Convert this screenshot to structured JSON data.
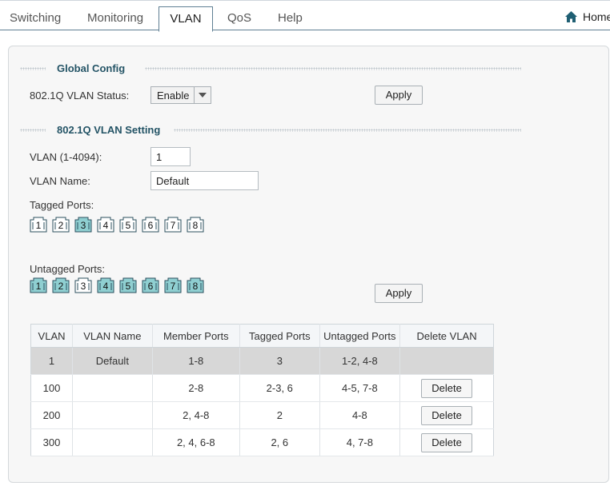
{
  "nav": {
    "tabs": [
      "Switching",
      "Monitoring",
      "VLAN",
      "QoS",
      "Help"
    ],
    "active_tab": "VLAN",
    "home_label": "Home",
    "home_icon": "house-icon"
  },
  "global_config": {
    "title": "Global Config",
    "status_label": "802.1Q VLAN Status:",
    "status_value": "Enable",
    "apply_label": "Apply"
  },
  "vlan_setting": {
    "title": "802.1Q VLAN Setting",
    "vlan_id_label": "VLAN (1-4094):",
    "vlan_id_value": "1",
    "vlan_name_label": "VLAN Name:",
    "vlan_name_value": "Default",
    "tagged_label": "Tagged Ports:",
    "untagged_label": "Untagged Ports:",
    "apply_label": "Apply",
    "ports": [
      "1",
      "2",
      "3",
      "4",
      "5",
      "6",
      "7",
      "8"
    ],
    "tagged_selected": [
      false,
      false,
      true,
      false,
      false,
      false,
      false,
      false
    ],
    "untagged_selected": [
      true,
      true,
      false,
      true,
      true,
      true,
      true,
      true
    ],
    "selected_color": "#8fcfd1",
    "unselected_color": "#ffffff"
  },
  "table": {
    "headers": [
      "VLAN",
      "VLAN Name",
      "Member Ports",
      "Tagged Ports",
      "Untagged Ports",
      "Delete VLAN"
    ],
    "rows": [
      {
        "vlan": "1",
        "name": "Default",
        "members": "1-8",
        "tagged": "3",
        "untagged": "1-2, 4-8",
        "delete": ""
      },
      {
        "vlan": "100",
        "name": "",
        "members": "2-8",
        "tagged": "2-3, 6",
        "untagged": "4-5, 7-8",
        "delete": "Delete"
      },
      {
        "vlan": "200",
        "name": "",
        "members": "2, 4-8",
        "tagged": "2",
        "untagged": "4-8",
        "delete": "Delete"
      },
      {
        "vlan": "300",
        "name": "",
        "members": "2, 4, 6-8",
        "tagged": "2, 6",
        "untagged": "4, 7-8",
        "delete": "Delete"
      }
    ]
  }
}
